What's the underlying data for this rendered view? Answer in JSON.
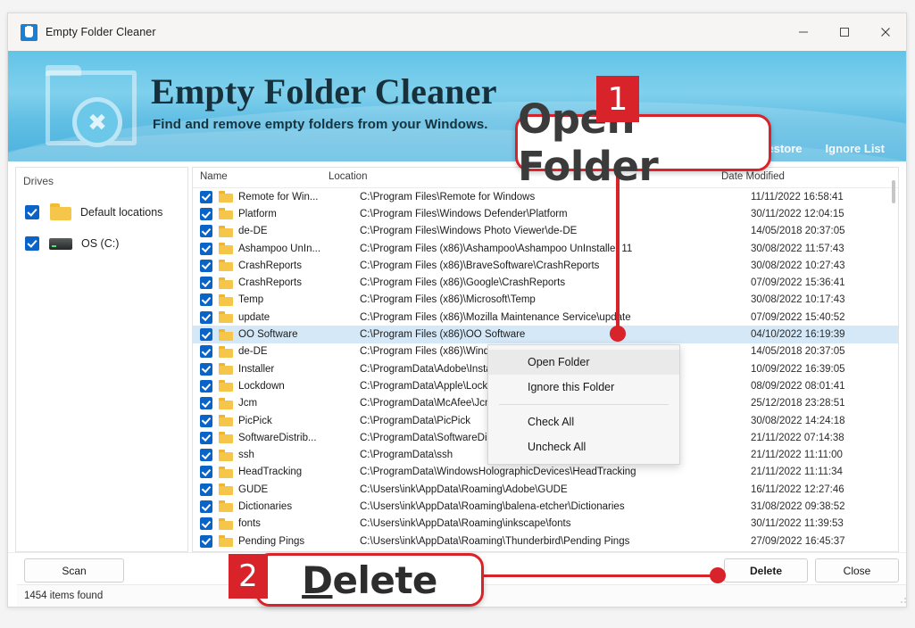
{
  "window": {
    "title": "Empty Folder Cleaner",
    "icon": "app-icon",
    "controls": {
      "minimize": "—",
      "maximize": "□",
      "close": "✕"
    }
  },
  "banner": {
    "title": "Empty Folder Cleaner",
    "subtitle": "Find and remove empty folders from your Windows.",
    "links": [
      "Restore",
      "Ignore List"
    ]
  },
  "drives": {
    "header": "Drives",
    "items": [
      {
        "label": "Default locations",
        "checked": true,
        "icon": "folder-icon"
      },
      {
        "label": "OS (C:)",
        "checked": true,
        "icon": "drive-icon"
      }
    ]
  },
  "list": {
    "columns": [
      "Name",
      "Location",
      "Date Modified"
    ],
    "rows": [
      {
        "name": "Remote for Win...",
        "location": "C:\\Program Files\\Remote for Windows",
        "date": "11/11/2022 16:58:41",
        "checked": true,
        "selected": false
      },
      {
        "name": "Platform",
        "location": "C:\\Program Files\\Windows Defender\\Platform",
        "date": "30/11/2022 12:04:15",
        "checked": true,
        "selected": false
      },
      {
        "name": "de-DE",
        "location": "C:\\Program Files\\Windows Photo Viewer\\de-DE",
        "date": "14/05/2018 20:37:05",
        "checked": true,
        "selected": false
      },
      {
        "name": "Ashampoo UnIn...",
        "location": "C:\\Program Files (x86)\\Ashampoo\\Ashampoo UnInstaller 11",
        "date": "30/08/2022 11:57:43",
        "checked": true,
        "selected": false
      },
      {
        "name": "CrashReports",
        "location": "C:\\Program Files (x86)\\BraveSoftware\\CrashReports",
        "date": "30/08/2022 10:27:43",
        "checked": true,
        "selected": false
      },
      {
        "name": "CrashReports",
        "location": "C:\\Program Files (x86)\\Google\\CrashReports",
        "date": "07/09/2022 15:36:41",
        "checked": true,
        "selected": false
      },
      {
        "name": "Temp",
        "location": "C:\\Program Files (x86)\\Microsoft\\Temp",
        "date": "30/08/2022 10:17:43",
        "checked": true,
        "selected": false
      },
      {
        "name": "update",
        "location": "C:\\Program Files (x86)\\Mozilla Maintenance Service\\update",
        "date": "07/09/2022 15:40:52",
        "checked": true,
        "selected": false
      },
      {
        "name": "OO Software",
        "location": "C:\\Program Files (x86)\\OO Software",
        "date": "04/10/2022 16:19:39",
        "checked": true,
        "selected": true
      },
      {
        "name": "de-DE",
        "location": "C:\\Program Files (x86)\\Windows",
        "date": "14/05/2018 20:37:05",
        "checked": true,
        "selected": false
      },
      {
        "name": "Installer",
        "location": "C:\\ProgramData\\Adobe\\Installer",
        "date": "10/09/2022 16:39:05",
        "checked": true,
        "selected": false
      },
      {
        "name": "Lockdown",
        "location": "C:\\ProgramData\\Apple\\Lockdown",
        "date": "08/09/2022 08:01:41",
        "checked": true,
        "selected": false
      },
      {
        "name": "Jcm",
        "location": "C:\\ProgramData\\McAfee\\Jcm",
        "date": "25/12/2018 23:28:51",
        "checked": true,
        "selected": false
      },
      {
        "name": "PicPick",
        "location": "C:\\ProgramData\\PicPick",
        "date": "30/08/2022 14:24:18",
        "checked": true,
        "selected": false
      },
      {
        "name": "SoftwareDistrib...",
        "location": "C:\\ProgramData\\SoftwareDistrib",
        "date": "21/11/2022 07:14:38",
        "checked": true,
        "selected": false
      },
      {
        "name": "ssh",
        "location": "C:\\ProgramData\\ssh",
        "date": "21/11/2022 11:11:00",
        "checked": true,
        "selected": false
      },
      {
        "name": "HeadTracking",
        "location": "C:\\ProgramData\\WindowsHolographicDevices\\HeadTracking",
        "date": "21/11/2022 11:11:34",
        "checked": true,
        "selected": false
      },
      {
        "name": "GUDE",
        "location": "C:\\Users\\ink\\AppData\\Roaming\\Adobe\\GUDE",
        "date": "16/11/2022 12:27:46",
        "checked": true,
        "selected": false
      },
      {
        "name": "Dictionaries",
        "location": "C:\\Users\\ink\\AppData\\Roaming\\balena-etcher\\Dictionaries",
        "date": "31/08/2022 09:38:52",
        "checked": true,
        "selected": false
      },
      {
        "name": "fonts",
        "location": "C:\\Users\\ink\\AppData\\Roaming\\inkscape\\fonts",
        "date": "30/11/2022 11:39:53",
        "checked": true,
        "selected": false
      },
      {
        "name": "Pending Pings",
        "location": "C:\\Users\\ink\\AppData\\Roaming\\Thunderbird\\Pending Pings",
        "date": "27/09/2022 16:45:37",
        "checked": true,
        "selected": false
      }
    ]
  },
  "context_menu": {
    "items": [
      {
        "label": "Open Folder",
        "highlighted": true
      },
      {
        "label": "Ignore this Folder",
        "highlighted": false
      },
      {
        "separator": true
      },
      {
        "label": "Check All",
        "highlighted": false
      },
      {
        "label": "Uncheck All",
        "highlighted": false
      }
    ]
  },
  "footer": {
    "scan": "Scan",
    "delete": "Delete",
    "close": "Close",
    "status": "1454 items found"
  },
  "annotations": {
    "step1": {
      "number": "1",
      "label": "Open Folder"
    },
    "step2": {
      "number": "2",
      "label_prefix": "D",
      "label_rest": "elete"
    },
    "accent": "#d8232a"
  }
}
